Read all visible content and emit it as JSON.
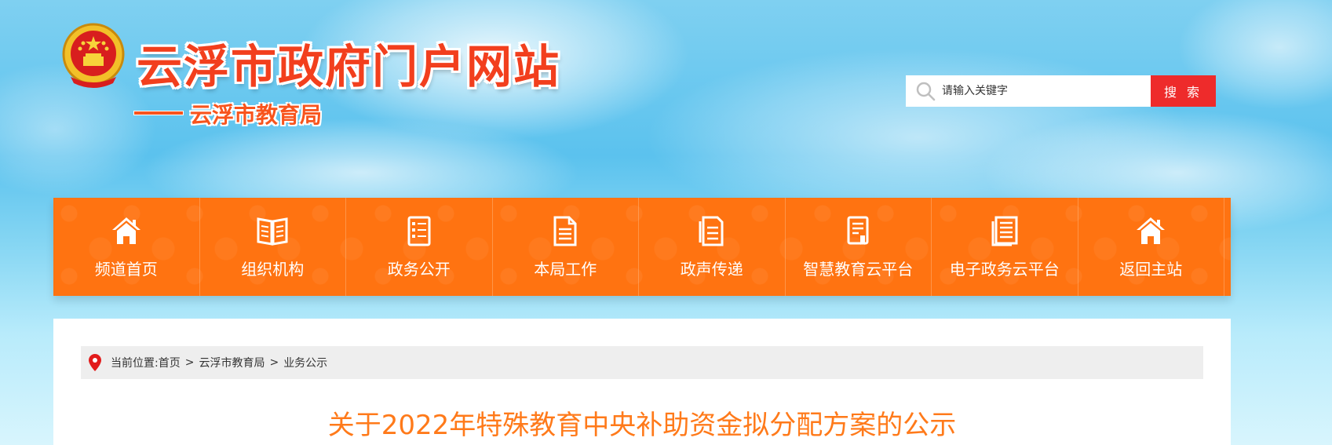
{
  "header": {
    "site_title": "云浮市政府门户网站",
    "sub_title": "云浮市教育局",
    "emblem_icon": "national-emblem-icon"
  },
  "search": {
    "placeholder": "请输入关键字",
    "button_label": "搜 索"
  },
  "nav": {
    "items": [
      {
        "label": "频道首页",
        "icon": "home-icon"
      },
      {
        "label": "组织机构",
        "icon": "book-icon"
      },
      {
        "label": "政务公开",
        "icon": "document-icon"
      },
      {
        "label": "本局工作",
        "icon": "file-icon"
      },
      {
        "label": "政声传递",
        "icon": "notes-icon"
      },
      {
        "label": "智慧教育云平台",
        "icon": "clipboard-icon"
      },
      {
        "label": "电子政务云平台",
        "icon": "list-document-icon"
      },
      {
        "label": "返回主站",
        "icon": "home-icon"
      }
    ]
  },
  "breadcrumb": {
    "prefix": "当前位置:",
    "items": [
      "首页",
      "云浮市教育局",
      "业务公示"
    ],
    "separator": ">"
  },
  "article": {
    "title": "关于2022年特殊教育中央补助资金拟分配方案的公示"
  },
  "colors": {
    "nav_bg": "#ff7311",
    "title_red": "#f23f1d",
    "search_button": "#ee2b2b",
    "article_title": "#ff7a1a"
  }
}
